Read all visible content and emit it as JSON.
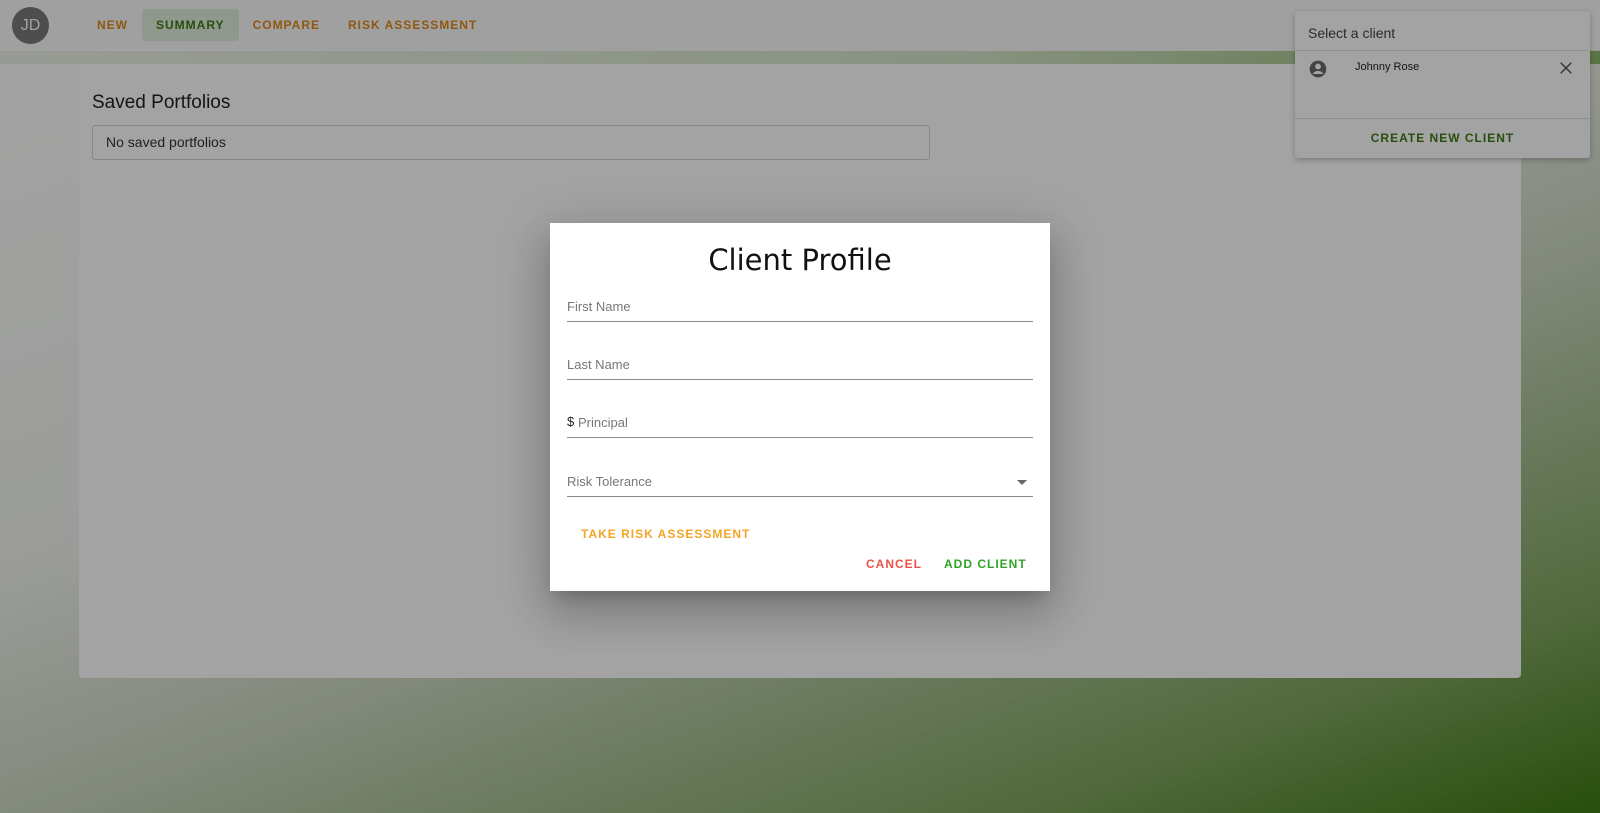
{
  "header": {
    "avatar_initials": "JD",
    "tabs": [
      {
        "label": "NEW",
        "active": false
      },
      {
        "label": "SUMMARY",
        "active": true
      },
      {
        "label": "COMPARE",
        "active": false
      },
      {
        "label": "RISK ASSESSMENT",
        "active": false
      }
    ]
  },
  "main": {
    "saved_title": "Saved Portfolios",
    "saved_empty_text": "No saved portfolios"
  },
  "client_panel": {
    "header": "Select a client",
    "clients": [
      {
        "name": "Johnny Rose"
      }
    ],
    "create_label": "CREATE NEW CLIENT"
  },
  "dialog": {
    "title": "Client Profile",
    "first_name_placeholder": "First Name",
    "last_name_placeholder": "Last Name",
    "principal_prefix": "$",
    "principal_placeholder": "Principal",
    "risk_label": "Risk Tolerance",
    "assess_label": "TAKE RISK ASSESSMENT",
    "cancel_label": "CANCEL",
    "add_label": "ADD CLIENT"
  },
  "colors": {
    "accent_orange": "#e08a1a",
    "accent_green": "#3f7a14",
    "cancel_red": "#e8534a",
    "add_green": "#2fa52a"
  }
}
